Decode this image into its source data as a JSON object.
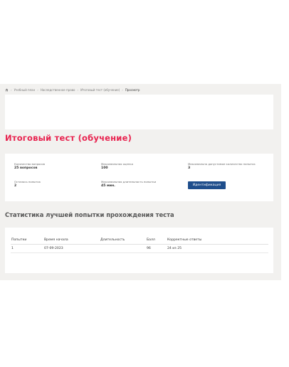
{
  "breadcrumb": {
    "items": [
      "Учебный план",
      "Наследственное право",
      "Итоговый тест (обучение)"
    ],
    "current": "Просмотр"
  },
  "page_title": "Итоговый тест (обучение)",
  "info": {
    "questions_label": "Количество вопросов",
    "questions_value": "25 вопросов",
    "max_score_label": "Максимальная оценка",
    "max_score_value": "100",
    "max_attempts_label": "Максимально допустимое количество попыток",
    "max_attempts_value": "3",
    "attempts_left_label": "Осталось попыток",
    "attempts_left_value": "2",
    "max_duration_label": "Максимальная длительность попытки",
    "max_duration_value": "45 мин.",
    "identify_button": "Идентификация"
  },
  "stats_title": "Статистика лучшей попытки прохождения теста",
  "table": {
    "headers": [
      "Попытки",
      "Время начала",
      "Длительность",
      "Балл",
      "Корректные ответы"
    ],
    "rows": [
      [
        "1",
        "07-09-2023",
        "",
        "96",
        "24 из 25"
      ]
    ]
  },
  "colors": {
    "accent": "#e8234f",
    "button": "#1f4e8c",
    "background": "#f2f1ef"
  }
}
